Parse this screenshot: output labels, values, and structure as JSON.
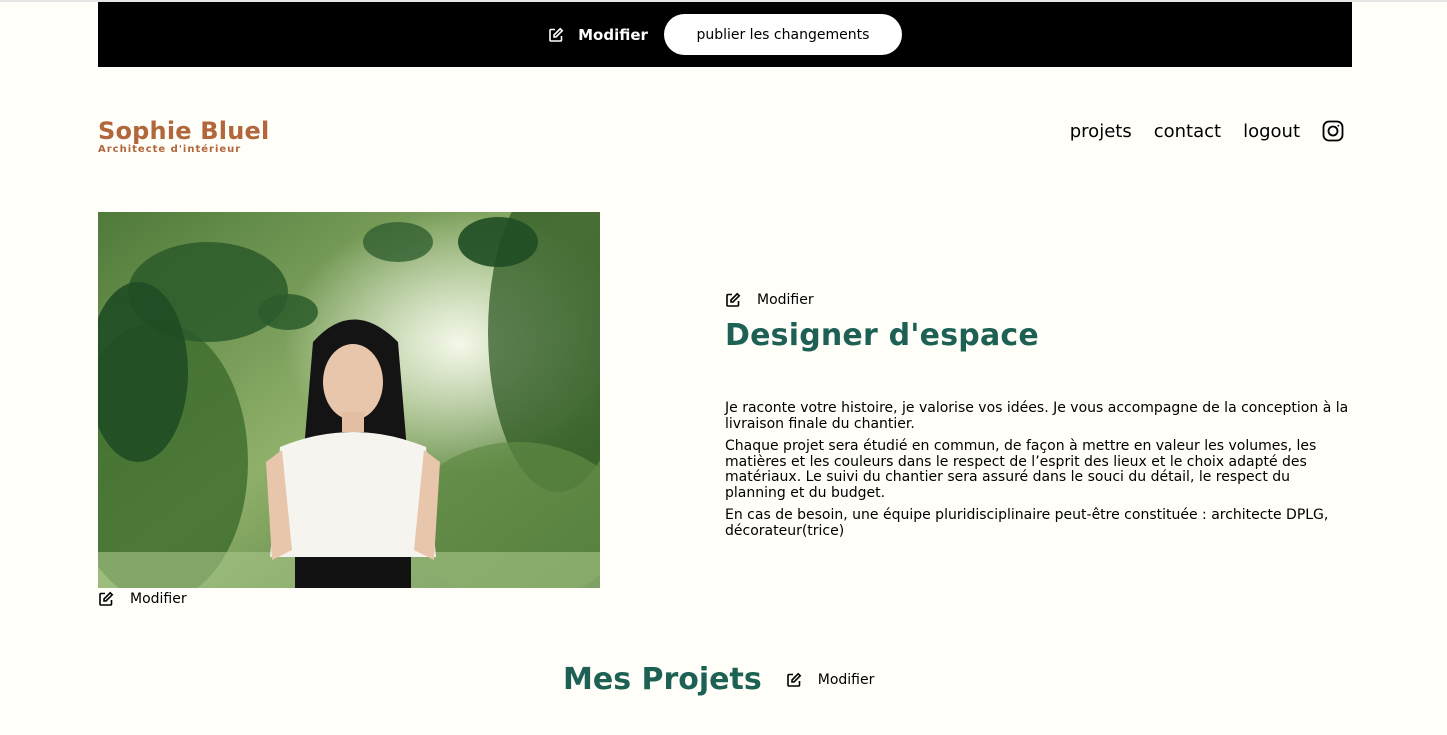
{
  "edit_bar": {
    "edit_label": "Modifier",
    "publish_label": "publier les changements"
  },
  "header": {
    "logo_title": "Sophie Bluel",
    "logo_subtitle": "Architecte d'intérieur",
    "nav": [
      "projets",
      "contact",
      "logout"
    ],
    "instagram_icon": "instagram-icon"
  },
  "photo": {
    "edit_label": "Modifier"
  },
  "intro": {
    "edit_label": "Modifier",
    "title": "Designer d'espace",
    "paragraphs": [
      "Je raconte votre histoire, je valorise vos idées. Je vous accompagne de la conception à la livraison finale du chantier.",
      "Chaque projet sera étudié en commun, de façon à mettre en valeur les volumes, les matières et les couleurs dans le respect de l’esprit des lieux et le choix adapté des matériaux. Le suivi du chantier sera assuré dans le souci du détail, le respect du planning et du budget.",
      "En cas de besoin, une équipe pluridisciplinaire peut-être constituée : architecte DPLG, décorateur(trice)"
    ]
  },
  "projects": {
    "title": "Mes Projets",
    "edit_label": "Modifier"
  },
  "colors": {
    "brand": "#B1663C",
    "accent": "#1D6154",
    "background": "#FFFEF8"
  }
}
